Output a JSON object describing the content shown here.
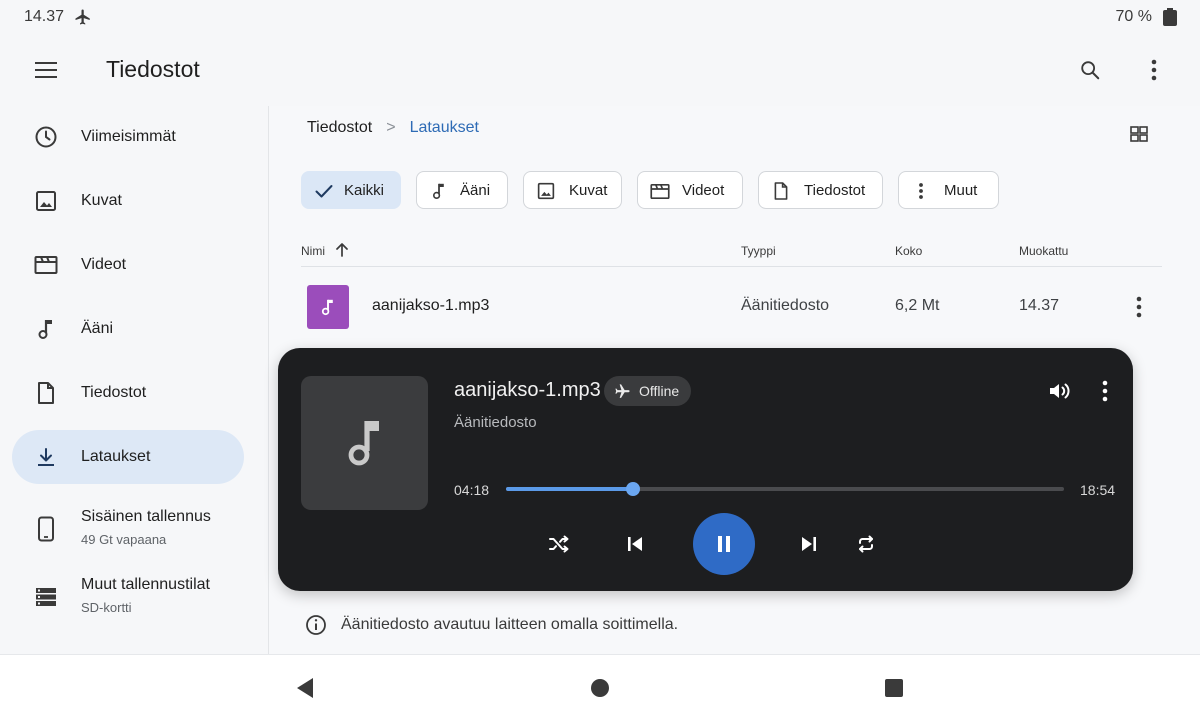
{
  "status": {
    "time": "14.37",
    "battery": "70 %"
  },
  "app": {
    "title": "Tiedostot"
  },
  "sidebar": {
    "items": [
      {
        "label": "Viimeisimmät",
        "icon": "clock-icon"
      },
      {
        "label": "Kuvat",
        "icon": "image-icon"
      },
      {
        "label": "Videot",
        "icon": "video-icon"
      },
      {
        "label": "Ääni",
        "icon": "music-note-icon"
      },
      {
        "label": "Tiedostot",
        "icon": "document-icon"
      },
      {
        "label": "Lataukset",
        "icon": "download-icon",
        "active": true
      },
      {
        "label": "Sisäinen tallennus",
        "sub": "49 Gt vapaana",
        "icon": "phone-icon"
      },
      {
        "label": "Muut tallennustilat",
        "sub": "SD-kortti",
        "icon": "storage-icon"
      }
    ]
  },
  "breadcrumb": {
    "root": "Tiedostot",
    "separator": ">",
    "current": "Lataukset"
  },
  "filters": [
    {
      "label": "Kaikki",
      "icon": "check-icon",
      "active": true
    },
    {
      "label": "Ääni",
      "icon": "music-note-icon"
    },
    {
      "label": "Kuvat",
      "icon": "image-icon"
    },
    {
      "label": "Videot",
      "icon": "video-icon"
    },
    {
      "label": "Tiedostot",
      "icon": "document-icon"
    },
    {
      "label": "Muut",
      "icon": "more-vert-icon"
    }
  ],
  "table": {
    "headers": {
      "name": "Nimi",
      "type": "Tyyppi",
      "size": "Koko",
      "modified": "Muokattu"
    },
    "rows": [
      {
        "name": "aanijakso-1.mp3",
        "type": "Äänitiedosto",
        "size": "6,2 Mt",
        "modified": "14.37"
      }
    ]
  },
  "player": {
    "title": "aanijakso-1.mp3",
    "badge": "Offline",
    "subtitle": "Äänitiedosto",
    "current_time": "04:18",
    "total_time": "18:54",
    "progress": 0.2275,
    "accent": "#2f6bc6"
  },
  "info": {
    "text": "Äänitiedosto avautuu laitteen omalla soittimella."
  }
}
